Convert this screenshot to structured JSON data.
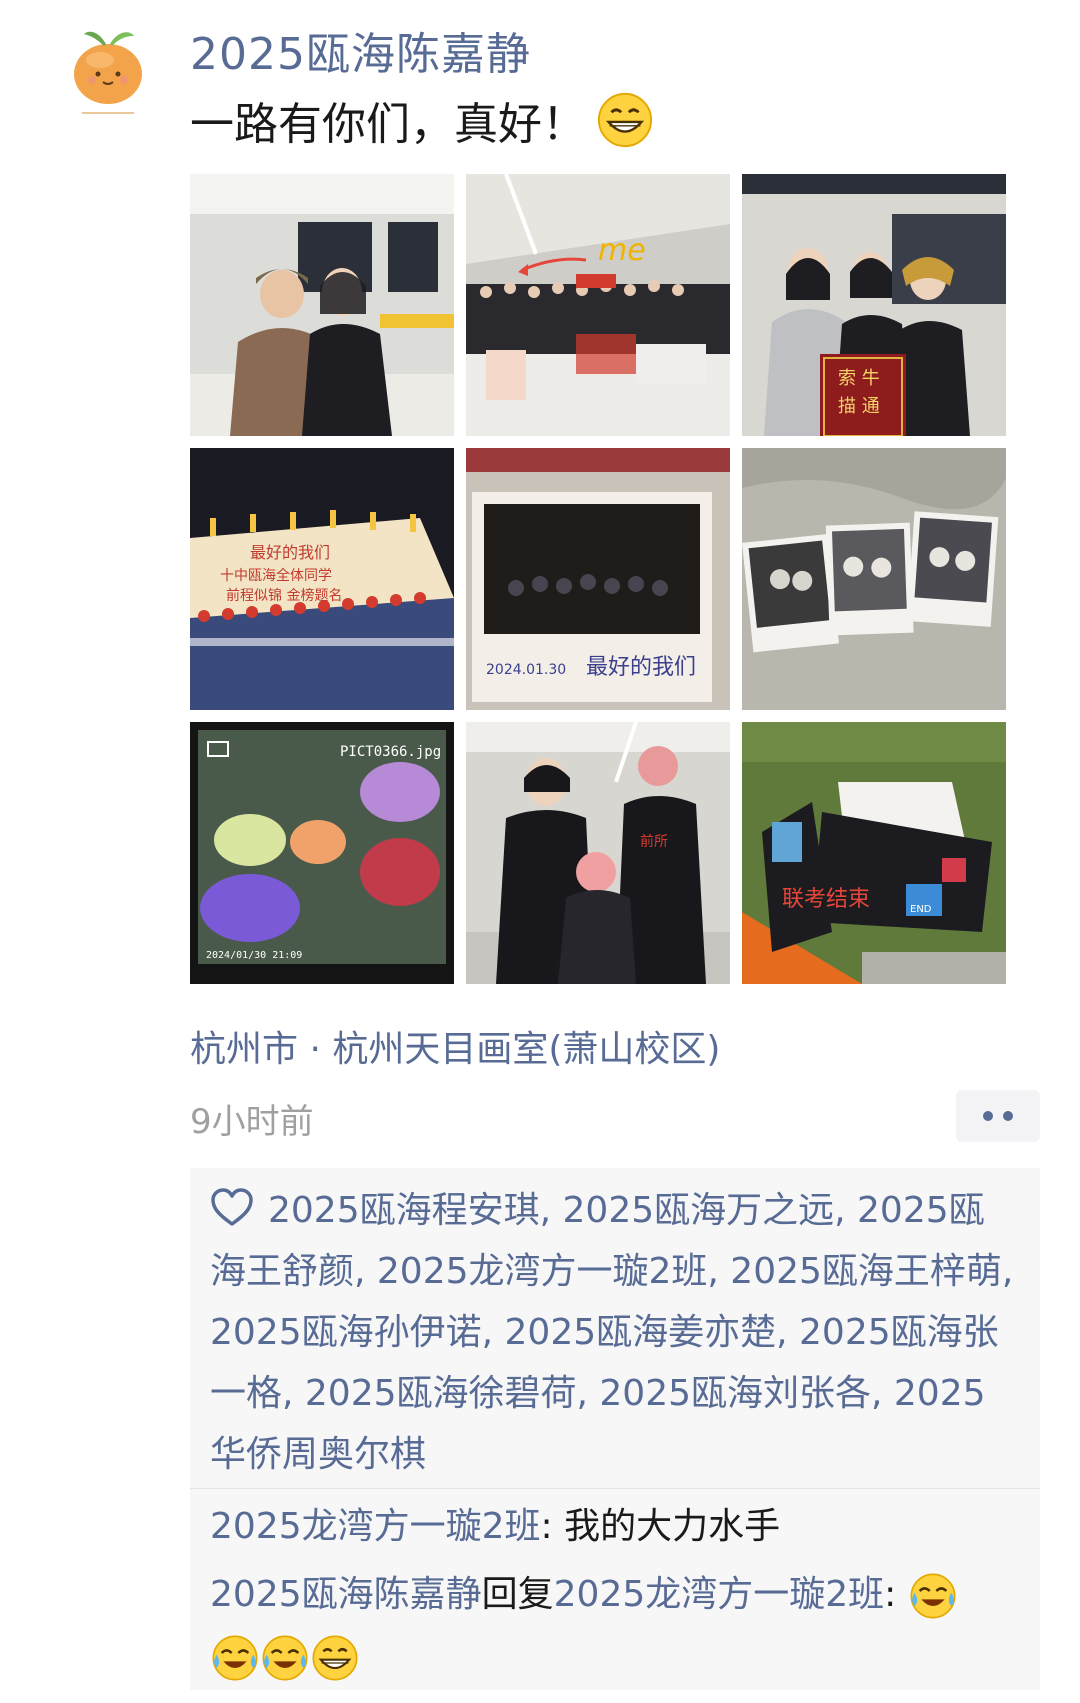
{
  "post": {
    "author": "2025瓯海陈嘉静",
    "text": "一路有你们，真好！",
    "text_emoji": "grin-emoji",
    "photos": [
      {
        "name": "photo-two-girls-classroom",
        "colors": [
          "#d9d9d6",
          "#8a6a52",
          "#1d1d22"
        ]
      },
      {
        "name": "photo-group-hall-me",
        "colors": [
          "#c9c7c2",
          "#2a2a2e",
          "#d23b2e"
        ]
      },
      {
        "name": "photo-three-girls-banner",
        "colors": [
          "#d6d4cf",
          "#1e1e22",
          "#8e1c1c"
        ]
      },
      {
        "name": "photo-cake",
        "colors": [
          "#2a3a66",
          "#f2e4c4",
          "#d23b2e"
        ]
      },
      {
        "name": "photo-polaroid-group",
        "colors": [
          "#efe9e0",
          "#1f1c1a",
          "#3a3f6e"
        ]
      },
      {
        "name": "photo-polaroids-bed",
        "colors": [
          "#b9b6ae",
          "#f4f2ee",
          "#3a3a3a"
        ]
      },
      {
        "name": "photo-camera-screen-toys",
        "colors": [
          "#4a5a4a",
          "#b68ad6",
          "#c23b4a"
        ]
      },
      {
        "name": "photo-friends-hallway",
        "colors": [
          "#d8d6d0",
          "#18181c",
          "#e89a9a"
        ]
      },
      {
        "name": "photo-bags-on-grass",
        "colors": [
          "#5f7a3a",
          "#f4f2ee",
          "#1c1c20"
        ]
      }
    ],
    "location": "杭州市 · 杭州天目画室(萧山校区)",
    "time_ago": "9小时前"
  },
  "likes": {
    "icon": "heart-icon",
    "names": "2025瓯海程安琪, 2025瓯海万之远, 2025瓯海王舒颜, 2025龙湾方一璇2班, 2025瓯海王梓萌, 2025瓯海孙伊诺, 2025瓯海姜亦楚, 2025瓯海张一格, 2025瓯海徐碧荷, 2025瓯海刘张各, 2025华侨周奥尔棋"
  },
  "comments": [
    {
      "name": "2025龙湾方一璇2班",
      "sep": ": ",
      "text": "我的大力水手"
    },
    {
      "name": "2025瓯海陈嘉静",
      "reply_word": "回复",
      "reply_to": "2025龙湾方一璇2班",
      "sep": ": ",
      "emojis": [
        "tears-of-joy-emoji",
        "tears-of-joy-emoji",
        "tears-of-joy-emoji",
        "grin-emoji"
      ]
    }
  ],
  "colors": {
    "link": "#576b95",
    "time": "#a0a0a0",
    "box": "#f7f7f7"
  }
}
